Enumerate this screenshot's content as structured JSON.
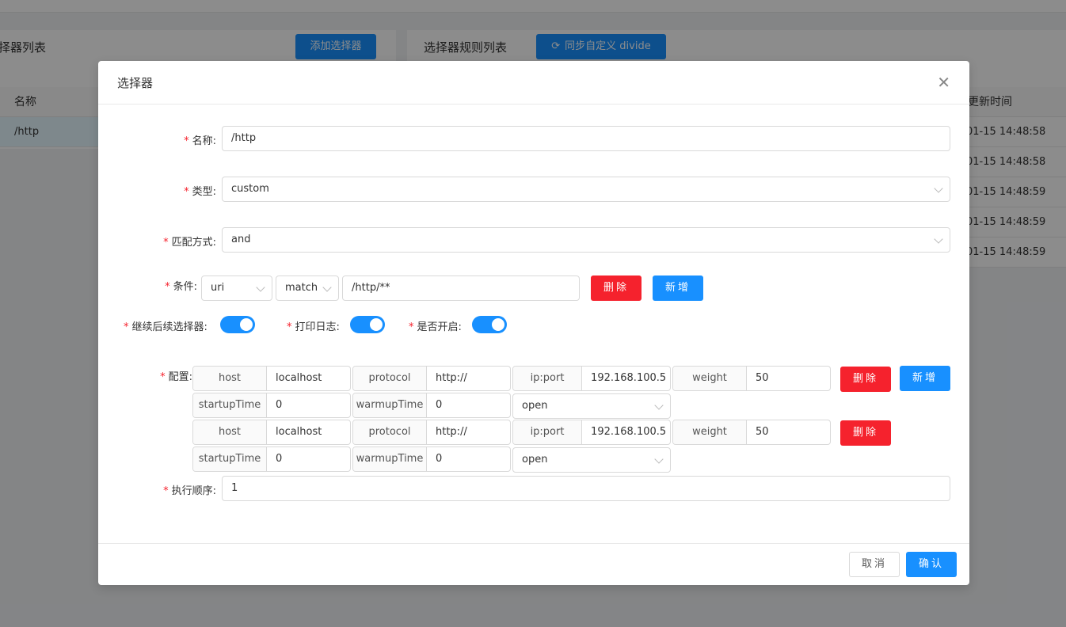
{
  "background": {
    "left_panel_title": "择器列表",
    "add_selector_button": "添加选择器",
    "right_panel_title": "选择器规则列表",
    "sync_button": "同步自定义 divide",
    "left_col_name": "名称",
    "left_row_name": "/http",
    "right_col_updated": "更新时间",
    "right_rows": [
      "01-15 14:48:58",
      "01-15 14:48:58",
      "01-15 14:48:59",
      "01-15 14:48:59",
      "01-15 14:48:59"
    ]
  },
  "modal": {
    "title": "选择器",
    "fields": {
      "name_label": "名称:",
      "name_value": "/http",
      "type_label": "类型:",
      "type_value": "custom",
      "match_mode_label": "匹配方式:",
      "match_mode_value": "and",
      "condition_label": "条件:",
      "condition_param_type": "uri",
      "condition_operator": "match",
      "condition_value": "/http/**",
      "delete_label": "删除",
      "add_label": "新增",
      "continued_label": "继续后续选择器:",
      "log_label": "打印日志:",
      "enabled_label": "是否开启:",
      "config_label": "配置:",
      "sort_label": "执行顺序:",
      "sort_value": "1"
    },
    "switches": {
      "continued": true,
      "logged": true,
      "enabled": true
    },
    "upstreams": [
      {
        "host_label": "host",
        "host": "localhost",
        "protocol_label": "protocol",
        "protocol": "http://",
        "ipport_label": "ip:port",
        "ipport": "192.168.100.5",
        "weight_label": "weight",
        "weight": "50",
        "startup_label": "startupTime",
        "startup": "0",
        "warmup_label": "warmupTime",
        "warmup": "0",
        "status": "open"
      },
      {
        "host_label": "host",
        "host": "localhost",
        "protocol_label": "protocol",
        "protocol": "http://",
        "ipport_label": "ip:port",
        "ipport": "192.168.100.5",
        "weight_label": "weight",
        "weight": "50",
        "startup_label": "startupTime",
        "startup": "0",
        "warmup_label": "warmupTime",
        "warmup": "0",
        "status": "open"
      }
    ],
    "footer": {
      "cancel": "取消",
      "confirm": "确认"
    }
  },
  "colors": {
    "primary": "#1890ff",
    "danger": "#f5222d",
    "required": "#f5222d"
  }
}
